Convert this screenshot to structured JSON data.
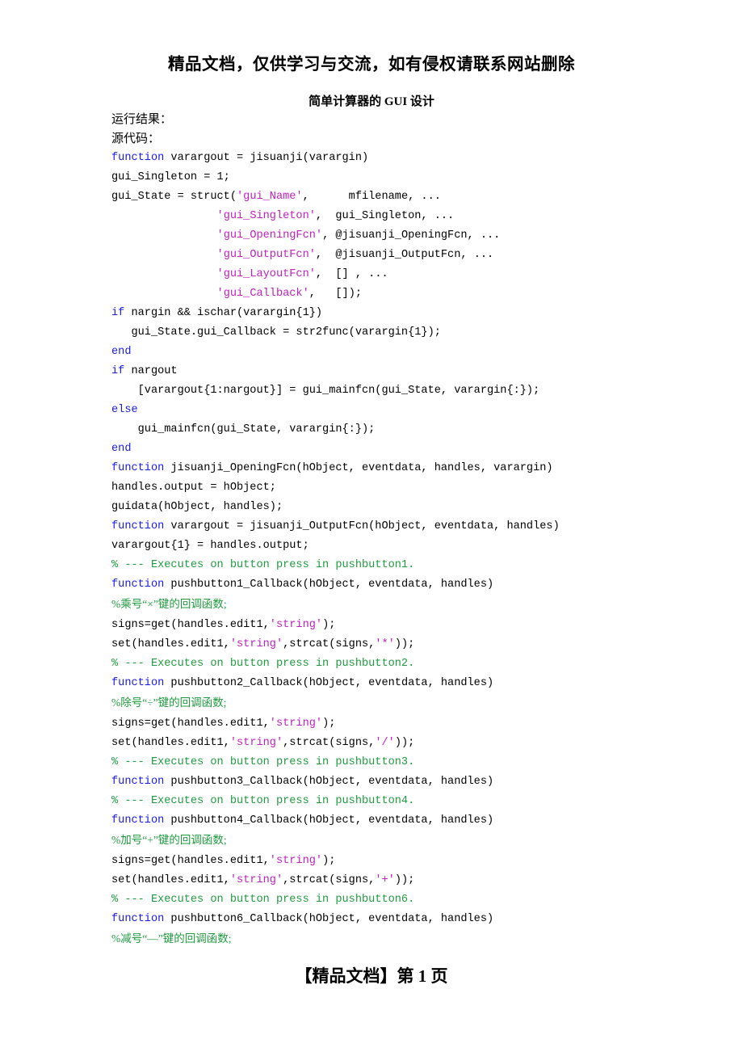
{
  "banner": "精品文档，仅供学习与交流，如有侵权请联系网站删除",
  "doc_title": "简单计算器的 GUI 设计",
  "intro": [
    "运行结果：",
    "源代码："
  ],
  "footer": "【精品文档】第 1 页",
  "code": [
    [
      {
        "t": "function",
        "c": "kw"
      },
      {
        "t": " varargout = jisuanji(varargin)",
        "c": ""
      }
    ],
    [
      {
        "t": "gui_Singleton = 1;",
        "c": ""
      }
    ],
    [
      {
        "t": "gui_State = struct(",
        "c": ""
      },
      {
        "t": "'gui_Name'",
        "c": "str"
      },
      {
        "t": ",      mfilename, ...",
        "c": ""
      }
    ],
    [
      {
        "t": "                ",
        "c": ""
      },
      {
        "t": "'gui_Singleton'",
        "c": "str"
      },
      {
        "t": ",  gui_Singleton, ...",
        "c": ""
      }
    ],
    [
      {
        "t": "                ",
        "c": ""
      },
      {
        "t": "'gui_OpeningFcn'",
        "c": "str"
      },
      {
        "t": ", @jisuanji_OpeningFcn, ...",
        "c": ""
      }
    ],
    [
      {
        "t": "                ",
        "c": ""
      },
      {
        "t": "'gui_OutputFcn'",
        "c": "str"
      },
      {
        "t": ",  @jisuanji_OutputFcn, ...",
        "c": ""
      }
    ],
    [
      {
        "t": "                ",
        "c": ""
      },
      {
        "t": "'gui_LayoutFcn'",
        "c": "str"
      },
      {
        "t": ",  [] , ...",
        "c": ""
      }
    ],
    [
      {
        "t": "                ",
        "c": ""
      },
      {
        "t": "'gui_Callback'",
        "c": "str"
      },
      {
        "t": ",   []);",
        "c": ""
      }
    ],
    [
      {
        "t": "if",
        "c": "kw"
      },
      {
        "t": " nargin && ischar(varargin{1})",
        "c": ""
      }
    ],
    [
      {
        "t": "   gui_State.gui_Callback = str2func(varargin{1});",
        "c": ""
      }
    ],
    [
      {
        "t": "end",
        "c": "kw"
      }
    ],
    [
      {
        "t": "if",
        "c": "kw"
      },
      {
        "t": " nargout",
        "c": ""
      }
    ],
    [
      {
        "t": "    [varargout{1:nargout}] = gui_mainfcn(gui_State, varargin{:});",
        "c": ""
      }
    ],
    [
      {
        "t": "else",
        "c": "kw"
      }
    ],
    [
      {
        "t": "    gui_mainfcn(gui_State, varargin{:});",
        "c": ""
      }
    ],
    [
      {
        "t": "end",
        "c": "kw"
      }
    ],
    [
      {
        "t": "function",
        "c": "kw"
      },
      {
        "t": " jisuanji_OpeningFcn(hObject, eventdata, handles, varargin)",
        "c": ""
      }
    ],
    [
      {
        "t": "handles.output = hObject;",
        "c": ""
      }
    ],
    [
      {
        "t": "guidata(hObject, handles);",
        "c": ""
      }
    ],
    [
      {
        "t": "function",
        "c": "kw"
      },
      {
        "t": " varargout = jisuanji_OutputFcn(hObject, eventdata, handles)",
        "c": ""
      }
    ],
    [
      {
        "t": "varargout{1} = handles.output;",
        "c": ""
      }
    ],
    [
      {
        "t": "% --- Executes on button press in pushbutton1.",
        "c": "cmt"
      }
    ],
    [
      {
        "t": "function",
        "c": "kw"
      },
      {
        "t": " pushbutton1_Callback(hObject, eventdata, handles)",
        "c": ""
      }
    ],
    [
      {
        "t": "%乘号“×”键的回调函数;",
        "c": "cmt cjk"
      }
    ],
    [
      {
        "t": "signs=get(handles.edit1,",
        "c": ""
      },
      {
        "t": "'string'",
        "c": "str"
      },
      {
        "t": ");",
        "c": ""
      }
    ],
    [
      {
        "t": "set(handles.edit1,",
        "c": ""
      },
      {
        "t": "'string'",
        "c": "str"
      },
      {
        "t": ",strcat(signs,",
        "c": ""
      },
      {
        "t": "'*'",
        "c": "str"
      },
      {
        "t": "));",
        "c": ""
      }
    ],
    [
      {
        "t": "% --- Executes on button press in pushbutton2.",
        "c": "cmt"
      }
    ],
    [
      {
        "t": "function",
        "c": "kw"
      },
      {
        "t": " pushbutton2_Callback(hObject, eventdata, handles)",
        "c": ""
      }
    ],
    [
      {
        "t": "%除号“÷”键的回调函数;",
        "c": "cmt cjk"
      }
    ],
    [
      {
        "t": "signs=get(handles.edit1,",
        "c": ""
      },
      {
        "t": "'string'",
        "c": "str"
      },
      {
        "t": ");",
        "c": ""
      }
    ],
    [
      {
        "t": "set(handles.edit1,",
        "c": ""
      },
      {
        "t": "'string'",
        "c": "str"
      },
      {
        "t": ",strcat(signs,",
        "c": ""
      },
      {
        "t": "'/'",
        "c": "str"
      },
      {
        "t": "));",
        "c": ""
      }
    ],
    [
      {
        "t": "% --- Executes on button press in pushbutton3.",
        "c": "cmt"
      }
    ],
    [
      {
        "t": "function",
        "c": "kw"
      },
      {
        "t": " pushbutton3_Callback(hObject, eventdata, handles)",
        "c": ""
      }
    ],
    [
      {
        "t": "% --- Executes on button press in pushbutton4.",
        "c": "cmt"
      }
    ],
    [
      {
        "t": "function",
        "c": "kw"
      },
      {
        "t": " pushbutton4_Callback(hObject, eventdata, handles)",
        "c": ""
      }
    ],
    [
      {
        "t": "%加号“+”键的回调函数;",
        "c": "cmt cjk"
      }
    ],
    [
      {
        "t": "signs=get(handles.edit1,",
        "c": ""
      },
      {
        "t": "'string'",
        "c": "str"
      },
      {
        "t": ");",
        "c": ""
      }
    ],
    [
      {
        "t": "set(handles.edit1,",
        "c": ""
      },
      {
        "t": "'string'",
        "c": "str"
      },
      {
        "t": ",strcat(signs,",
        "c": ""
      },
      {
        "t": "'+'",
        "c": "str"
      },
      {
        "t": "));",
        "c": ""
      }
    ],
    [
      {
        "t": "% --- Executes on button press in pushbutton6.",
        "c": "cmt"
      }
    ],
    [
      {
        "t": "function",
        "c": "kw"
      },
      {
        "t": " pushbutton6_Callback(hObject, eventdata, handles)",
        "c": ""
      }
    ],
    [
      {
        "t": "%减号“—”键的回调函数;",
        "c": "cmt cjk"
      }
    ]
  ]
}
